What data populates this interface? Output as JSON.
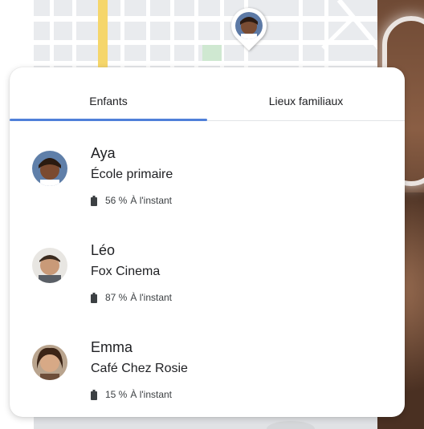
{
  "tabs": [
    {
      "label": "Enfants",
      "active": true
    },
    {
      "label": "Lieux familiaux",
      "active": false
    }
  ],
  "children": [
    {
      "name": "Aya",
      "place": "École primaire",
      "battery": "56 %",
      "updated": "À l'instant",
      "avatar_icon": "avatar-photo-icon"
    },
    {
      "name": "Léo",
      "place": "Fox Cinema",
      "battery": "87 %",
      "updated": "À l'instant",
      "avatar_icon": "avatar-photo-icon"
    },
    {
      "name": "Emma",
      "place": "Café Chez Rosie",
      "battery": "15 %",
      "updated": "À l'instant",
      "avatar_icon": "avatar-photo-icon"
    }
  ],
  "colors": {
    "accent": "#4f80d9",
    "map_background": "#e9ebee",
    "map_road": "#ffffff",
    "map_highlight_road": "#f5d66b",
    "park": "#cfe8d1"
  },
  "icons": {
    "battery": "battery-icon",
    "map_pin": "map-pin-icon"
  }
}
